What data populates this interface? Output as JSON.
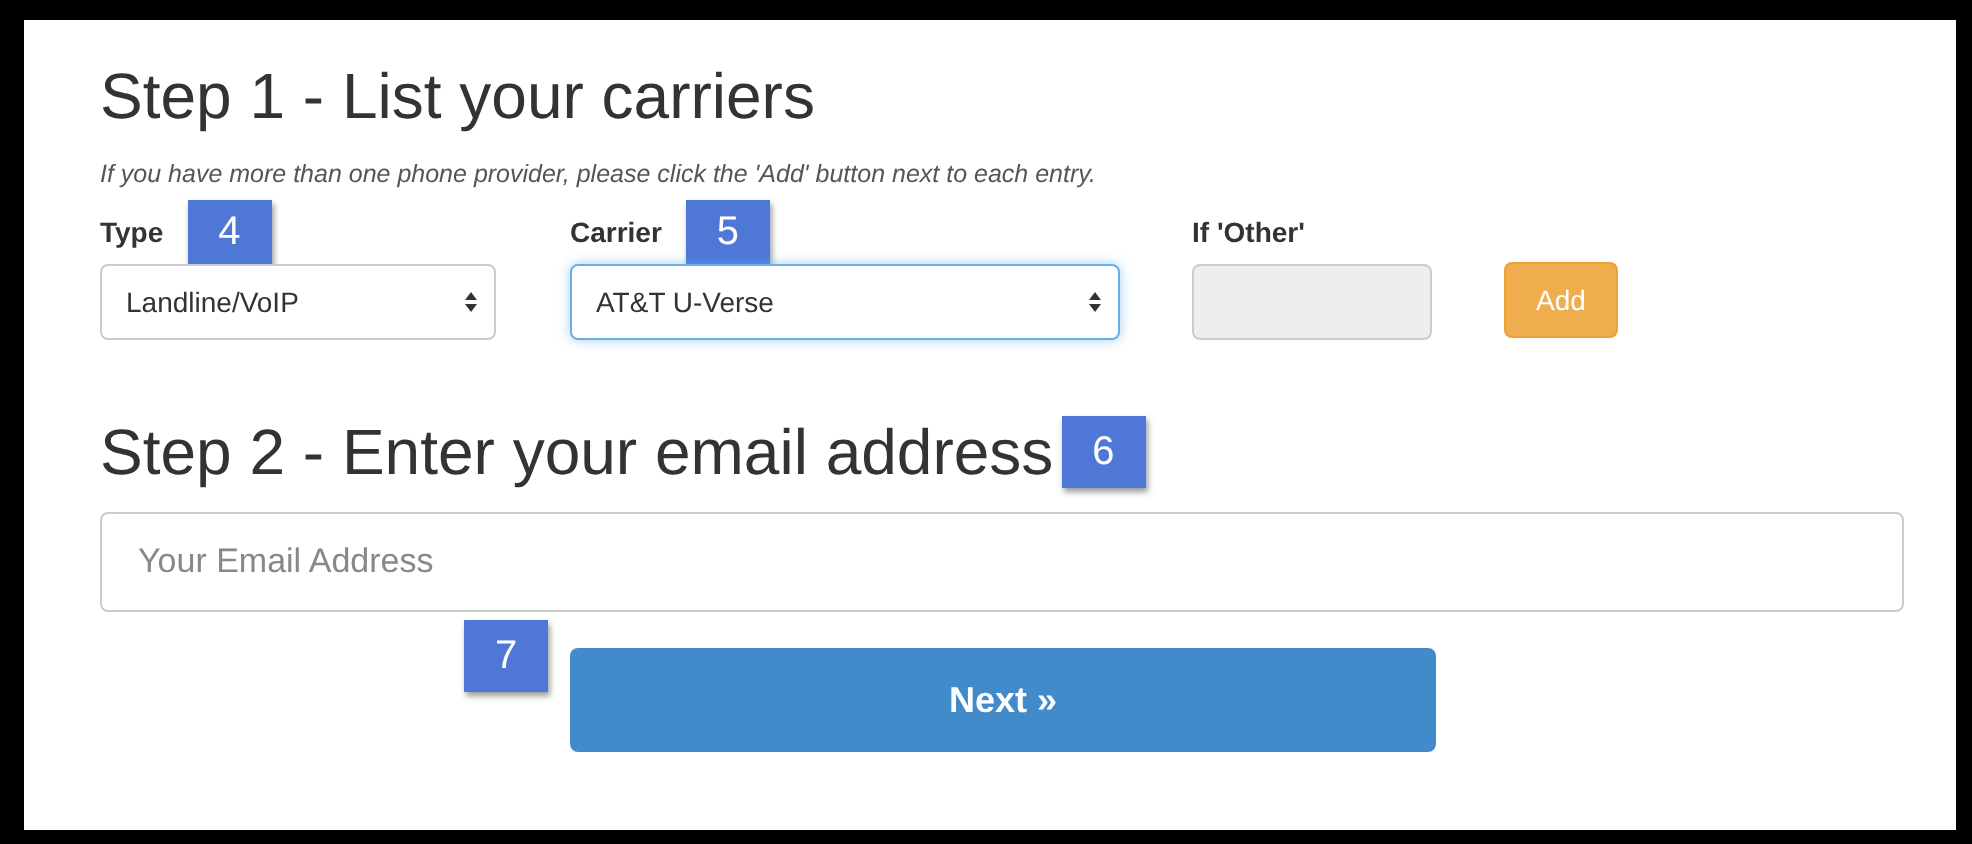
{
  "step1": {
    "title": "Step 1 - List your carriers",
    "hint": "If you have more than one phone provider, please click the 'Add' button next to each entry.",
    "type_field": {
      "label": "Type",
      "badge": "4",
      "value": "Landline/VoIP",
      "focused": false
    },
    "carrier_field": {
      "label": "Carrier",
      "badge": "5",
      "value": "AT&T U-Verse",
      "focused": true
    },
    "other_field": {
      "label": "If 'Other'",
      "disabled": true
    },
    "add_button": "Add"
  },
  "step2": {
    "title": "Step 2 - Enter your email address",
    "badge": "6",
    "email": {
      "placeholder": "Your Email Address"
    },
    "next_button": {
      "label": "Next »",
      "badge": "7"
    }
  }
}
